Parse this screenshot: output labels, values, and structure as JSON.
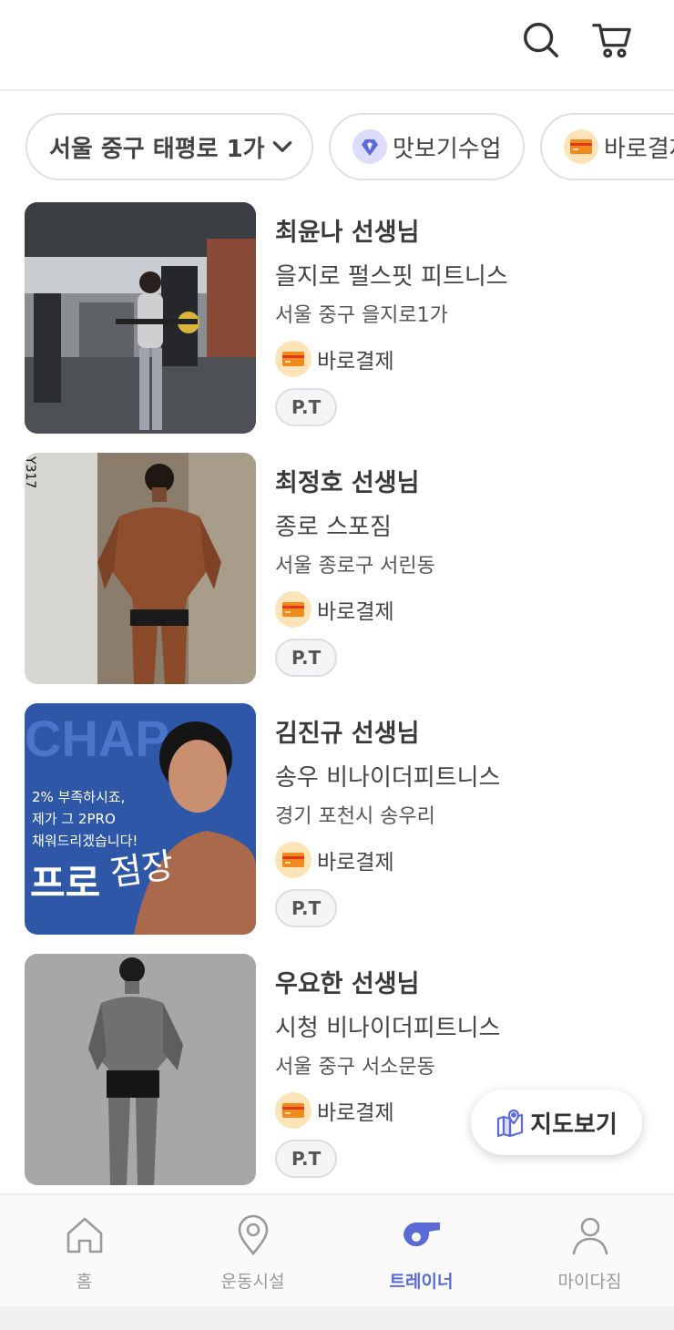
{
  "header": {
    "icons": [
      "search-icon",
      "cart-icon"
    ]
  },
  "filters": {
    "location": "서울 중구 태평로 1가",
    "taste_class": "맛보기수업",
    "direct_pay": "바로결제"
  },
  "trainers": [
    {
      "name": "최윤나 선생님",
      "gym": "을지로 펄스핏 피트니스",
      "address": "서울 중구 을지로1가",
      "payment": "바로결제",
      "tag": "P.T"
    },
    {
      "name": "최정호 선생님",
      "gym": "종로 스포짐",
      "address": "서울 종로구 서린동",
      "payment": "바로결제",
      "tag": "P.T"
    },
    {
      "name": "김진규 선생님",
      "gym": "송우 비나이더피트니스",
      "address": "경기 포천시 송우리",
      "payment": "바로결제",
      "tag": "P.T"
    },
    {
      "name": "우요한 선생님",
      "gym": "시청 비나이더피트니스",
      "address": "서울 중구 서소문동",
      "payment": "바로결제",
      "tag": "P.T"
    }
  ],
  "thumbnails": {
    "photo2_text": "Y317",
    "promo": {
      "bg_word": "CHAP",
      "line1": "2% 부족하시죠,",
      "line2": "제가 그 2PRO",
      "line3": "채워드리겠습니다!",
      "big1": "프로",
      "big2": "점장"
    }
  },
  "map_button": {
    "label": "지도보기"
  },
  "tabs": [
    {
      "label": "홈",
      "icon": "home-icon"
    },
    {
      "label": "운동시설",
      "icon": "location-pin-icon"
    },
    {
      "label": "트레이너",
      "icon": "whistle-icon",
      "active": true
    },
    {
      "label": "마이다짐",
      "icon": "person-icon"
    }
  ],
  "colors": {
    "accent": "#5a6bd8",
    "pay_badge": "#fde3b8",
    "taste_badge": "#dcdcfb"
  }
}
